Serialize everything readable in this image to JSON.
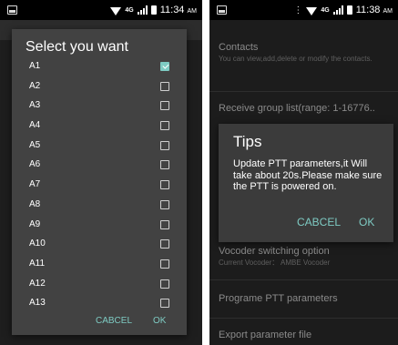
{
  "left_screen": {
    "status": {
      "time": "11:34",
      "ampm": "AM",
      "network": "4G"
    },
    "dialog": {
      "title": "Select you want",
      "options": [
        {
          "label": "A1",
          "checked": true
        },
        {
          "label": "A2",
          "checked": false
        },
        {
          "label": "A3",
          "checked": false
        },
        {
          "label": "A4",
          "checked": false
        },
        {
          "label": "A5",
          "checked": false
        },
        {
          "label": "A6",
          "checked": false
        },
        {
          "label": "A7",
          "checked": false
        },
        {
          "label": "A8",
          "checked": false
        },
        {
          "label": "A9",
          "checked": false
        },
        {
          "label": "A10",
          "checked": false
        },
        {
          "label": "A11",
          "checked": false
        },
        {
          "label": "A12",
          "checked": false
        },
        {
          "label": "A13",
          "checked": false
        }
      ],
      "cancel_label": "CABCEL",
      "ok_label": "OK"
    }
  },
  "right_screen": {
    "status": {
      "time": "11:38",
      "ampm": "AM",
      "network": "4G"
    },
    "settings": {
      "contacts_title": "Contacts",
      "contacts_sub": "You can view,add,delete or modify the contacts.",
      "receive_title": "Receive group list(range: 1-16776..",
      "vocoder_title": "Vocoder switching option",
      "vocoder_sub": "Current Vocoder： AMBE Vocoder",
      "program_title": "Programe PTT parameters",
      "export_title": "Export parameter file"
    },
    "dialog": {
      "title": "Tips",
      "message": "Update PTT parameters,it Will take about 20s.Please make sure the PTT is powered on.",
      "cancel_label": "CABCEL",
      "ok_label": "OK"
    }
  },
  "colors": {
    "accent": "#7ecbc3",
    "dialog_bg": "#424242",
    "screen_bg": "#1e1e1e"
  }
}
